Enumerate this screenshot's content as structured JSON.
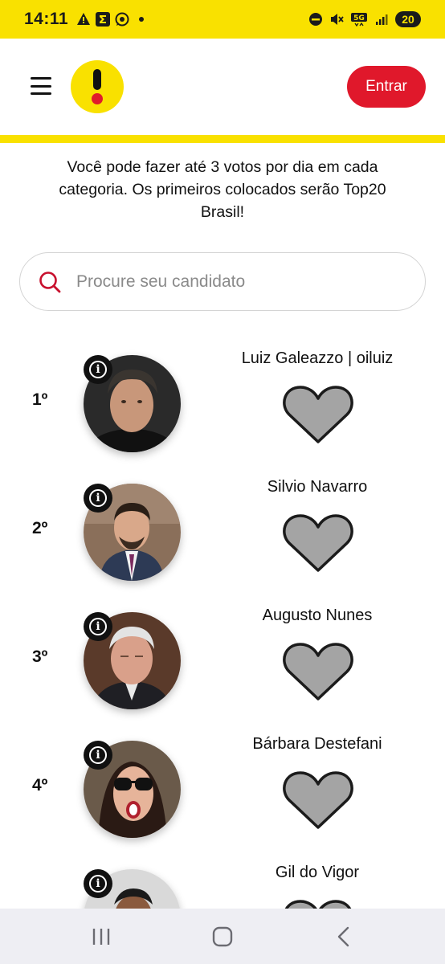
{
  "status_bar": {
    "time": "14:11",
    "battery": "20",
    "network": "5G",
    "left_icons": [
      "warning-icon",
      "sigma-icon",
      "whatsapp-icon",
      "dot-icon"
    ],
    "right_icons": [
      "dnd-icon",
      "mute-icon",
      "5g-icon",
      "signal-icon",
      "battery-icon"
    ]
  },
  "header": {
    "menu_icon": "hamburger-menu-icon",
    "logo": "exclamation-logo",
    "enter_label": "Entrar",
    "colors": {
      "brand_yellow": "#f9e100",
      "accent_red": "#e0182b"
    }
  },
  "intro": {
    "text": "Você pode fazer até 3 votos por dia em cada categoria. Os primeiros colocados serão Top20 Brasil!"
  },
  "search": {
    "placeholder": "Procure seu candidato",
    "value": "",
    "icon": "search-icon"
  },
  "candidates": [
    {
      "rank": "1º",
      "name": "Luiz Galeazzo | oiluiz"
    },
    {
      "rank": "2º",
      "name": "Silvio Navarro"
    },
    {
      "rank": "3º",
      "name": "Augusto Nunes"
    },
    {
      "rank": "4º",
      "name": "Bárbara Destefani"
    },
    {
      "rank": "",
      "name": "Gil do Vigor"
    }
  ],
  "nav": {
    "icons": [
      "recent-apps-icon",
      "home-icon",
      "back-icon"
    ]
  }
}
